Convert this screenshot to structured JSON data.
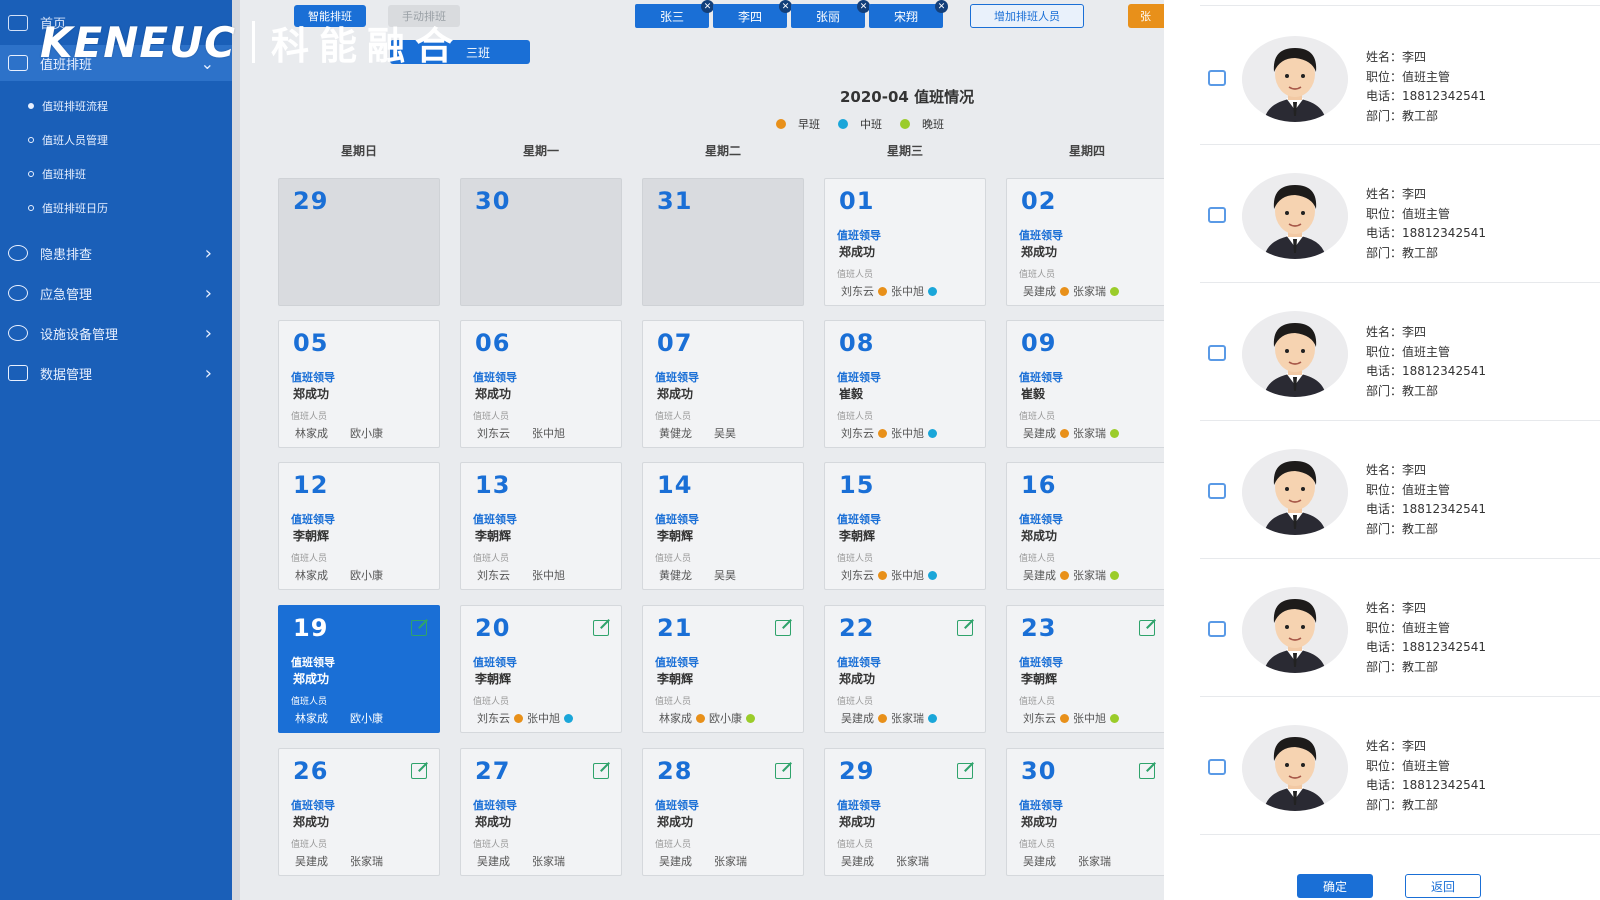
{
  "logo": {
    "en": "KENEUC",
    "cn": "科能融合"
  },
  "sidebar": {
    "top_label": "首页",
    "active_label": "值班排班",
    "sub_items": [
      {
        "label": "值班排班流程"
      },
      {
        "label": "值班人员管理"
      },
      {
        "label": "值班排班"
      },
      {
        "label": "值班排班日历"
      }
    ],
    "groups": [
      {
        "label": "隐患排查"
      },
      {
        "label": "应急管理"
      },
      {
        "label": "设施设备管理"
      },
      {
        "label": "数据管理"
      }
    ]
  },
  "toolbar": {
    "smart_tab": "智能排班",
    "manual_tab": "手动排班",
    "shift_label": "三班",
    "people": [
      "张三",
      "李四",
      "张丽",
      "宋翔"
    ],
    "add_person": "增加排班人员",
    "orange_btn": "张"
  },
  "calendar": {
    "title": "2020-04 值班情况",
    "legend": [
      {
        "label": "早班",
        "color": "#e8901a"
      },
      {
        "label": "中班",
        "color": "#1aa6d9"
      },
      {
        "label": "晚班",
        "color": "#9bcc2a"
      }
    ],
    "weekdays": [
      "星期日",
      "星期一",
      "星期二",
      "星期三",
      "星期四"
    ],
    "lead_label": "值班领导",
    "staff_label": "值班人员",
    "cells": [
      {
        "day": "29",
        "gray": true
      },
      {
        "day": "30",
        "gray": true
      },
      {
        "day": "31",
        "gray": true
      },
      {
        "day": "01",
        "lead": "郑成功",
        "staff": [
          "刘东云",
          "张中旭"
        ],
        "dots": [
          "#e8901a",
          "#1aa6d9"
        ]
      },
      {
        "day": "02",
        "lead": "郑成功",
        "staff": [
          "吴建成",
          "张家瑞"
        ],
        "dots": [
          "#e8901a",
          "#9bcc2a"
        ]
      },
      {
        "day": "05",
        "lead": "郑成功",
        "staff": [
          "林家成",
          "欧小康"
        ]
      },
      {
        "day": "06",
        "lead": "郑成功",
        "staff": [
          "刘东云",
          "张中旭"
        ]
      },
      {
        "day": "07",
        "lead": "郑成功",
        "staff": [
          "黄健龙",
          "吴昊"
        ]
      },
      {
        "day": "08",
        "lead": "崔毅",
        "staff": [
          "刘东云",
          "张中旭"
        ],
        "dots": [
          "#e8901a",
          "#1aa6d9"
        ]
      },
      {
        "day": "09",
        "lead": "崔毅",
        "staff": [
          "吴建成",
          "张家瑞"
        ],
        "dots": [
          "#e8901a",
          "#9bcc2a"
        ]
      },
      {
        "day": "12",
        "lead": "李朝辉",
        "staff": [
          "林家成",
          "欧小康"
        ]
      },
      {
        "day": "13",
        "lead": "李朝辉",
        "staff": [
          "刘东云",
          "张中旭"
        ]
      },
      {
        "day": "14",
        "lead": "李朝辉",
        "staff": [
          "黄健龙",
          "吴昊"
        ]
      },
      {
        "day": "15",
        "lead": "李朝辉",
        "staff": [
          "刘东云",
          "张中旭"
        ],
        "dots": [
          "#e8901a",
          "#1aa6d9"
        ]
      },
      {
        "day": "16",
        "lead": "郑成功",
        "staff": [
          "吴建成",
          "张家瑞"
        ],
        "dots": [
          "#e8901a",
          "#9bcc2a"
        ]
      },
      {
        "day": "19",
        "lead": "郑成功",
        "staff": [
          "林家成",
          "欧小康"
        ],
        "selected": true,
        "edit": true
      },
      {
        "day": "20",
        "lead": "李朝辉",
        "staff": [
          "刘东云",
          "张中旭"
        ],
        "dots": [
          "#e8901a",
          "#1aa6d9"
        ],
        "edit": true
      },
      {
        "day": "21",
        "lead": "李朝辉",
        "staff": [
          "林家成",
          "欧小康"
        ],
        "dots": [
          "#e8901a",
          "#9bcc2a"
        ],
        "edit": true
      },
      {
        "day": "22",
        "lead": "郑成功",
        "staff": [
          "吴建成",
          "张家瑞"
        ],
        "dots": [
          "#e8901a",
          "#1aa6d9"
        ],
        "edit": true
      },
      {
        "day": "23",
        "lead": "李朝辉",
        "staff": [
          "刘东云",
          "张中旭"
        ],
        "dots": [
          "#e8901a",
          "#9bcc2a"
        ],
        "edit": true
      },
      {
        "day": "26",
        "lead": "郑成功",
        "staff": [
          "吴建成",
          "张家瑞"
        ],
        "edit": true
      },
      {
        "day": "27",
        "lead": "郑成功",
        "staff": [
          "吴建成",
          "张家瑞"
        ],
        "edit": true
      },
      {
        "day": "28",
        "lead": "郑成功",
        "staff": [
          "吴建成",
          "张家瑞"
        ],
        "edit": true
      },
      {
        "day": "29",
        "lead": "郑成功",
        "staff": [
          "吴建成",
          "张家瑞"
        ],
        "edit": true
      },
      {
        "day": "30",
        "lead": "郑成功",
        "staff": [
          "吴建成",
          "张家瑞"
        ],
        "edit": true
      }
    ]
  },
  "panel": {
    "people": [
      {
        "name": "姓名：李四",
        "title": "职位：值班主管",
        "phone": "电话：18812342541",
        "dept": "部门：教工部"
      },
      {
        "name": "姓名：李四",
        "title": "职位：值班主管",
        "phone": "电话：18812342541",
        "dept": "部门：教工部"
      },
      {
        "name": "姓名：李四",
        "title": "职位：值班主管",
        "phone": "电话：18812342541",
        "dept": "部门：教工部"
      },
      {
        "name": "姓名：李四",
        "title": "职位：值班主管",
        "phone": "电话：18812342541",
        "dept": "部门：教工部"
      },
      {
        "name": "姓名：李四",
        "title": "职位：值班主管",
        "phone": "电话：18812342541",
        "dept": "部门：教工部"
      },
      {
        "name": "姓名：李四",
        "title": "职位：值班主管",
        "phone": "电话：18812342541",
        "dept": "部门：教工部"
      }
    ],
    "confirm": "确定",
    "back": "返回"
  }
}
